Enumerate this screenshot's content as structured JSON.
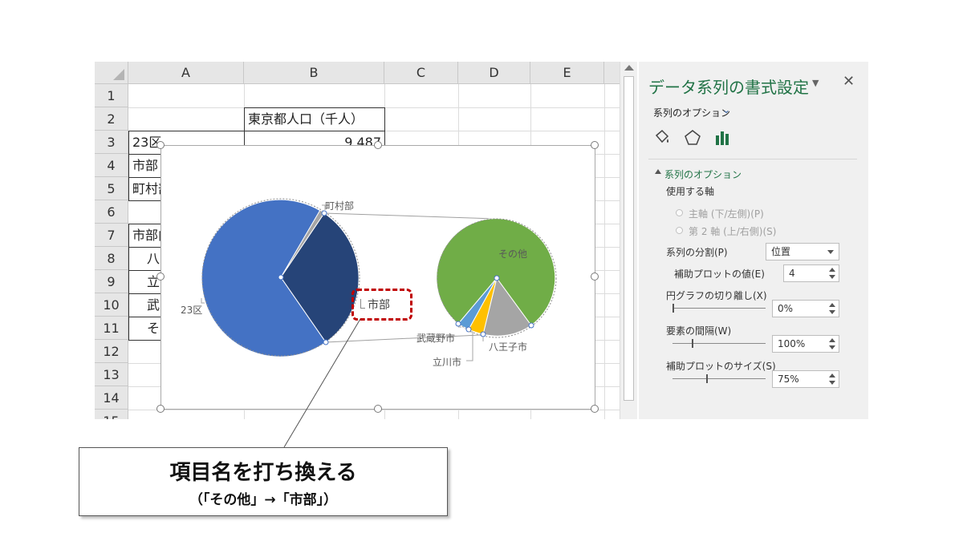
{
  "sheet": {
    "columns": [
      "A",
      "B",
      "C",
      "D",
      "E"
    ],
    "rows": [
      "1",
      "2",
      "3",
      "4",
      "5",
      "6",
      "7",
      "8",
      "9",
      "10",
      "11",
      "12",
      "13",
      "14",
      "15"
    ],
    "cells": {
      "B2": "東京都人口（千人）",
      "A3": "23区",
      "B3": "9,487",
      "A4": "市部",
      "A5": "町村部",
      "A7": "市部内",
      "A8": "八",
      "A9": "立",
      "A10": "武",
      "A11": "そ"
    }
  },
  "chart": {
    "labels": {
      "wards": "23区",
      "towns": "町村部",
      "other": "その他",
      "musashino": "武蔵野市",
      "tachikawa": "立川市",
      "hachioji": "八王子市",
      "city_renamed": "市部"
    },
    "colors": {
      "wards": "#4472c4",
      "towns": "#a5a5a5",
      "cities": "#264478",
      "other": "#70ad47",
      "musashino": "#5b9bd5",
      "tachikawa": "#ffc000",
      "hachioji": "#a5a5a5"
    }
  },
  "pane": {
    "title": "データ系列の書式設定",
    "options_label": "系列のオプション",
    "section": "系列のオプション",
    "axis_label": "使用する軸",
    "primary_axis": "主軸 (下/左側)(P)",
    "secondary_axis": "第 2 軸 (上/右側)(S)",
    "split_label": "系列の分割(P)",
    "split_value": "位置",
    "second_plot_value_label": "補助プロットの値(E)",
    "second_plot_value": "4",
    "explosion_label": "円グラフの切り離し(X)",
    "explosion_value": "0%",
    "gap_label": "要素の間隔(W)",
    "gap_value": "100%",
    "second_plot_size_label": "補助プロットのサイズ(S)",
    "second_plot_size_value": "75%",
    "icons": [
      "fill-bucket-icon",
      "pentagon-icon",
      "bar-chart-icon"
    ]
  },
  "callout": {
    "main": "項目名を打ち換える",
    "sub": "（「その他」→「市部」）"
  }
}
